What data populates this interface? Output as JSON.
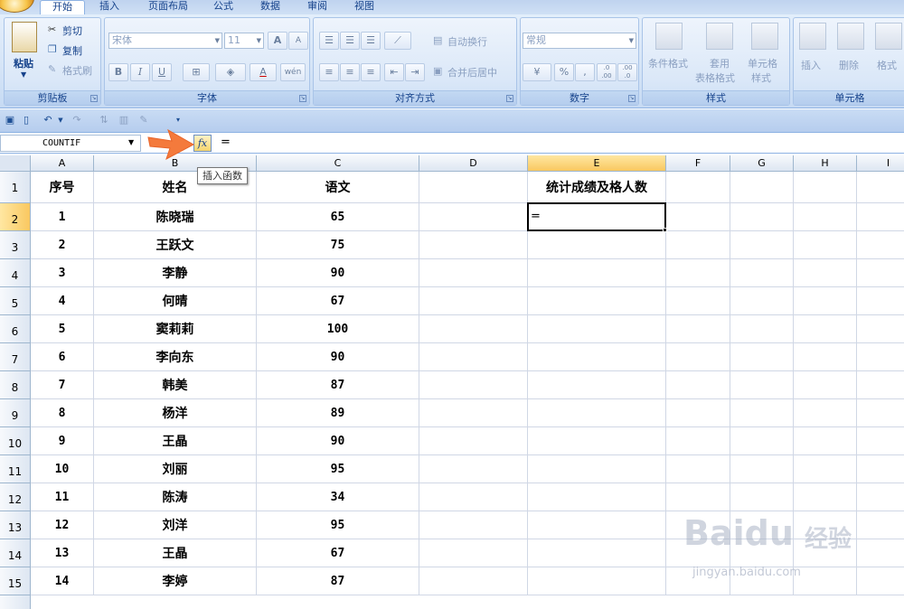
{
  "tabs": [
    {
      "label": "开始",
      "active": true
    },
    {
      "label": "插入"
    },
    {
      "label": "页面布局"
    },
    {
      "label": "公式"
    },
    {
      "label": "数据"
    },
    {
      "label": "审阅"
    },
    {
      "label": "视图"
    }
  ],
  "ribbon": {
    "clipboard": {
      "paste": "粘贴",
      "cut": "剪切",
      "copy": "复制",
      "format_painter": "格式刷",
      "label": "剪贴板"
    },
    "font": {
      "name": "宋体",
      "size": "11",
      "grow": "A",
      "shrink": "A",
      "bold": "B",
      "italic": "I",
      "underline": "U",
      "wen": "wén",
      "label": "字体"
    },
    "alignment": {
      "wrap": "自动换行",
      "merge": "合并后居中",
      "label": "对齐方式"
    },
    "number": {
      "format": "常规",
      "percent": "%",
      "comma": ",",
      "inc": ".0 .00",
      "dec": ".00 .0",
      "label": "数字"
    },
    "styles": {
      "conditional_line1": "条件格式",
      "table_line1": "套用",
      "table_line2": "表格格式",
      "cell_line1": "单元格",
      "cell_line2": "样式",
      "label": "样式"
    },
    "cells": {
      "insert": "插入",
      "delete": "删除",
      "format": "格式",
      "label": "单元格"
    }
  },
  "formula_bar": {
    "name_box": "COUNTIF",
    "fx": "fx",
    "formula": "=",
    "tooltip": "插入函数"
  },
  "grid": {
    "columns": [
      "A",
      "B",
      "C",
      "D",
      "E",
      "F",
      "G",
      "H",
      "I"
    ],
    "rows": [
      "1",
      "2",
      "3",
      "4",
      "5",
      "6",
      "7",
      "8",
      "9",
      "10",
      "11",
      "12",
      "13",
      "14",
      "15"
    ],
    "headers": {
      "seq": "序号",
      "name": "姓名",
      "score": "语文",
      "stat": "统计成绩及格人数"
    },
    "data": [
      {
        "seq": "1",
        "name": "陈晓瑞",
        "score": "65"
      },
      {
        "seq": "2",
        "name": "王跃文",
        "score": "75"
      },
      {
        "seq": "3",
        "name": "李静",
        "score": "90"
      },
      {
        "seq": "4",
        "name": "何晴",
        "score": "67"
      },
      {
        "seq": "5",
        "name": "窦莉莉",
        "score": "100"
      },
      {
        "seq": "6",
        "name": "李向东",
        "score": "90"
      },
      {
        "seq": "7",
        "name": "韩美",
        "score": "87"
      },
      {
        "seq": "8",
        "name": "杨洋",
        "score": "89"
      },
      {
        "seq": "9",
        "name": "王晶",
        "score": "90"
      },
      {
        "seq": "10",
        "name": "刘丽",
        "score": "95"
      },
      {
        "seq": "11",
        "name": "陈涛",
        "score": "34"
      },
      {
        "seq": "12",
        "name": "刘洋",
        "score": "95"
      },
      {
        "seq": "13",
        "name": "王晶",
        "score": "67"
      },
      {
        "seq": "14",
        "name": "李婷",
        "score": "87"
      }
    ],
    "active_cell_value": "="
  },
  "watermark": {
    "brand": "Baidu",
    "cn": "经验",
    "url": "jingyan.baidu.com"
  },
  "colors": {
    "accent": "#f47a3c",
    "ribbon": "#dbe8f8",
    "select": "#f9c860"
  }
}
